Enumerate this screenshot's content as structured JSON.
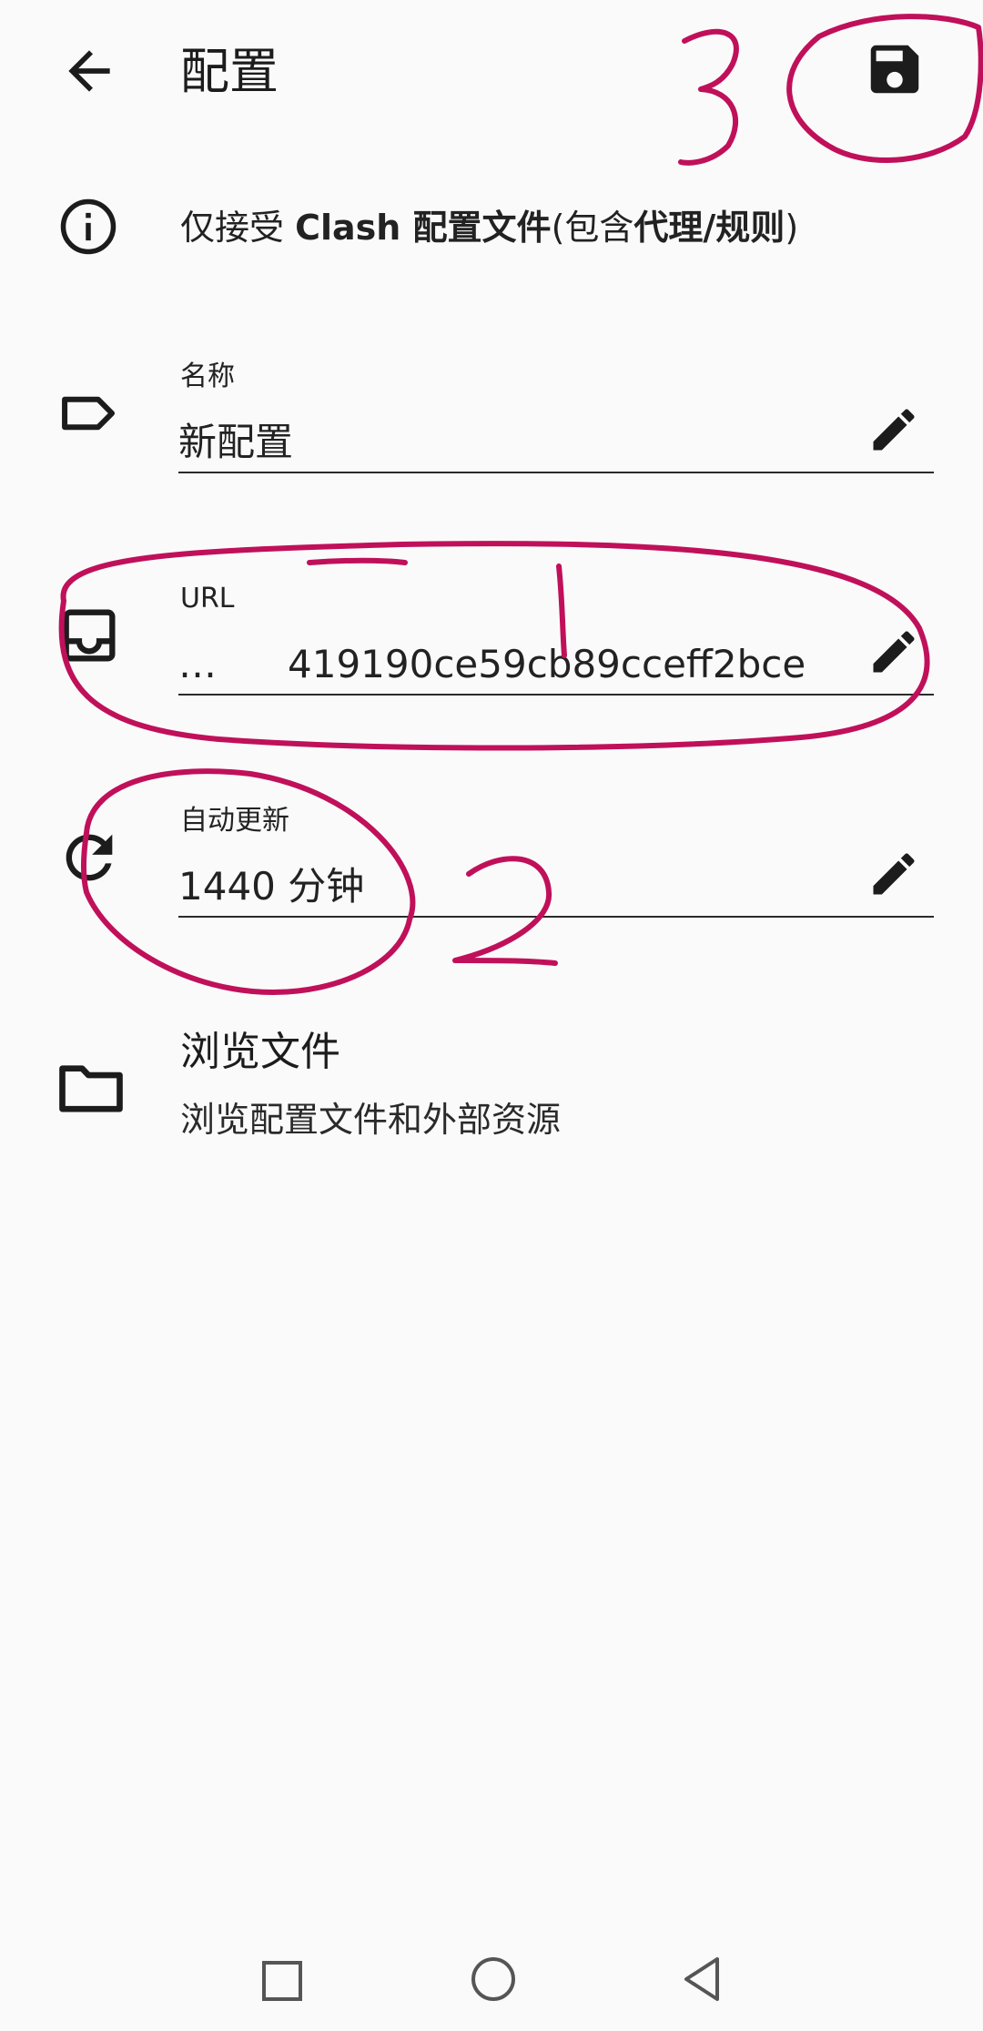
{
  "app_bar": {
    "title": "配置"
  },
  "info": {
    "parts": [
      "仅接受 ",
      "Clash 配置文件",
      "(包含",
      "代理",
      "/",
      "规则",
      ")"
    ]
  },
  "fields": {
    "name": {
      "label": "名称",
      "value": "新配置"
    },
    "url": {
      "label": "URL",
      "ellipsis": "…",
      "value": "419190ce59cb89cceff2bce"
    },
    "auto_update": {
      "label": "自动更新",
      "value": "1440 分钟"
    }
  },
  "browse": {
    "title": "浏览文件",
    "subtitle": "浏览配置文件和外部资源"
  },
  "annotations": {
    "color": "#c0105a",
    "labels": [
      "1",
      "2",
      "3"
    ]
  },
  "icons": {
    "back": "arrow-back-icon",
    "save": "save-icon",
    "info": "info-icon",
    "name": "label-icon",
    "url": "inbox-icon",
    "auto_update": "refresh-icon",
    "edit": "pencil-icon",
    "browse": "folder-icon"
  },
  "colors": {
    "background": "#fafafa",
    "text": "#1c1c1c"
  }
}
